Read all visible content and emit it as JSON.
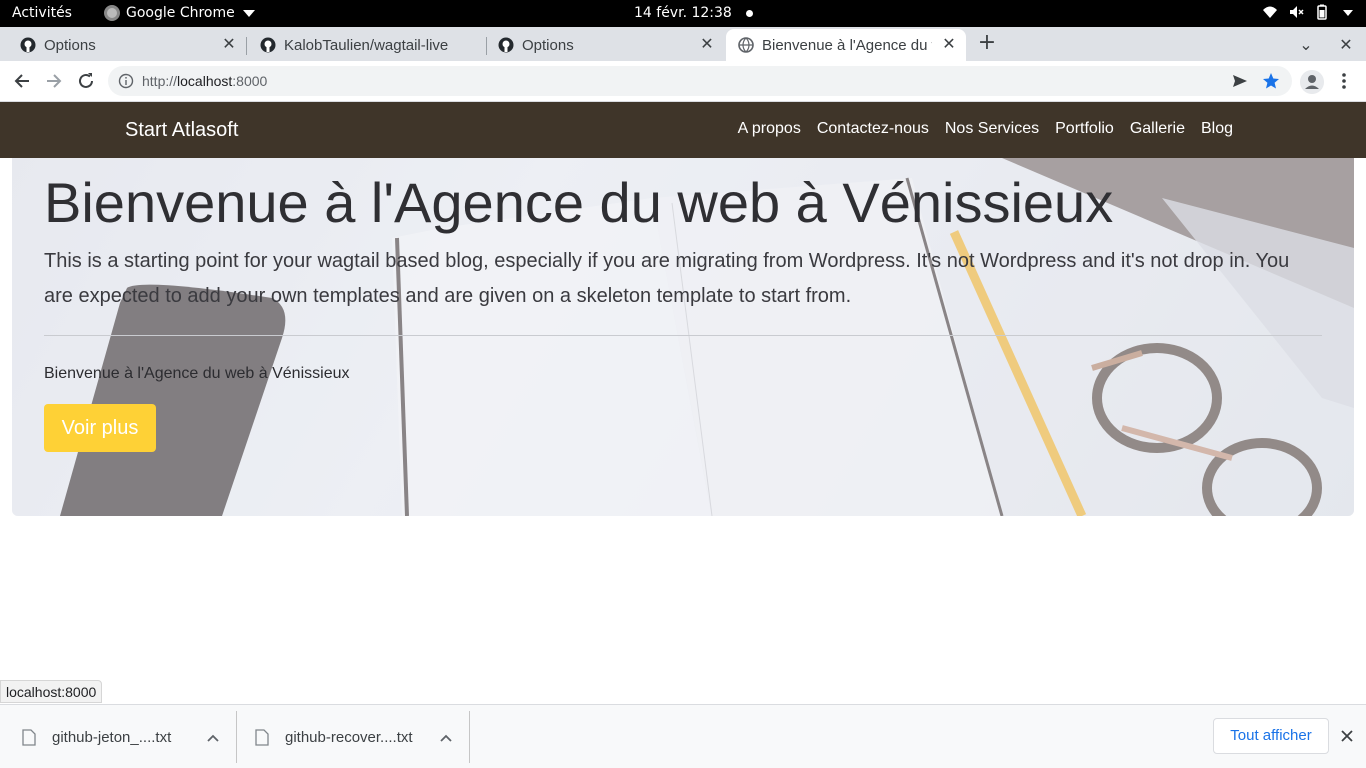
{
  "desktop": {
    "activities": "Activités",
    "app_name": "Google Chrome",
    "clock": "14 févr.  12:38"
  },
  "tabs": [
    {
      "title": "Options",
      "icon": "github-icon",
      "active": false
    },
    {
      "title": "KalobTaulien/wagtail-live",
      "icon": "github-icon",
      "active": false
    },
    {
      "title": "Options",
      "icon": "github-icon",
      "active": false
    },
    {
      "title": "Bienvenue à l'Agence du w",
      "icon": "globe-icon",
      "active": true
    }
  ],
  "toolbar": {
    "url_scheme": "http://",
    "url_host": "localhost",
    "url_port": ":8000"
  },
  "site": {
    "brand": "Start Atlasoft",
    "nav": [
      "A propos",
      "Contactez-nous",
      "Nos Services",
      "Portfolio",
      "Gallerie",
      "Blog"
    ],
    "hero": {
      "title": "Bienvenue à l'Agence du web à Vénissieux",
      "lead": "This is a starting point for your wagtail based blog, especially if you are migrating from Wordpress. It's not Wordpress and it's not drop in. You are expected to add your own templates and are given on a skeleton template to start from.",
      "sub": "Bienvenue à l'Agence du web à Vénissieux",
      "button": "Voir plus",
      "button_color": "#fed136"
    },
    "nav_bg": "#3f3529"
  },
  "status_url": "localhost:8000",
  "downloads": {
    "items": [
      "github-jeton_....txt",
      "github-recover....txt"
    ],
    "show_all": "Tout afficher"
  }
}
